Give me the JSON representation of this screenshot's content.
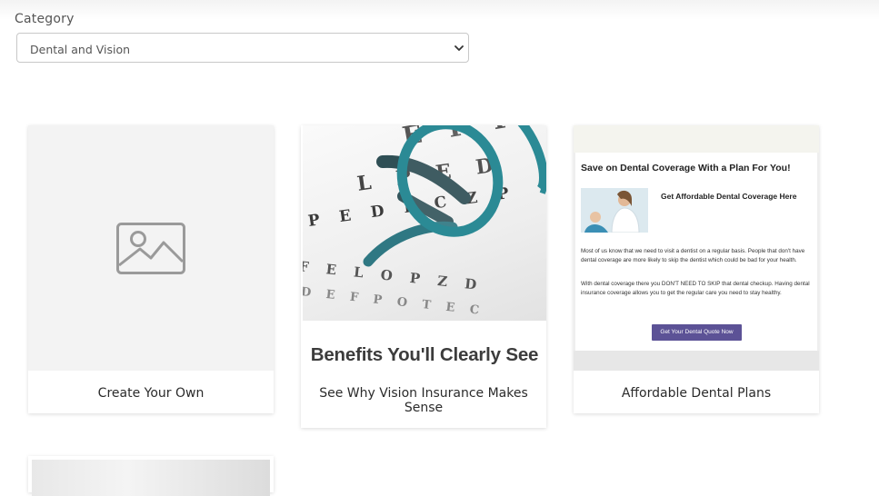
{
  "category": {
    "label": "Category",
    "selected": "Dental and Vision"
  },
  "cards": [
    {
      "caption": "Create Your Own"
    },
    {
      "caption": "See Why Vision Insurance Makes Sense",
      "eye_chart_rows": [
        "E F P",
        "L P E D",
        "P E D F C Z P",
        "F E L O P Z D",
        "D E F P O T E C"
      ],
      "banner": "Benefits You'll Clearly See"
    },
    {
      "caption": "Affordable Dental Plans",
      "email": {
        "title": "Save on Dental Coverage With a Plan For You!",
        "subtitle": "Get Affordable Dental Coverage Here",
        "paragraph1": "Most of us know that we need to visit a dentist on a regular basis. People that don't have dental coverage are more likely to skip the dentist which could be bad for your health.",
        "paragraph2": "With dental coverage there you DON'T NEED TO SKIP that dental checkup. Having dental insurance coverage allows you to get the regular care you need to stay healthy.",
        "button": "Get Your Dental Quote Now",
        "button_color": "#5c5296"
      }
    },
    {
      "caption": ""
    }
  ],
  "icons": {
    "image_placeholder": "image-placeholder-icon",
    "dropdown": "chevron-down-icon"
  }
}
